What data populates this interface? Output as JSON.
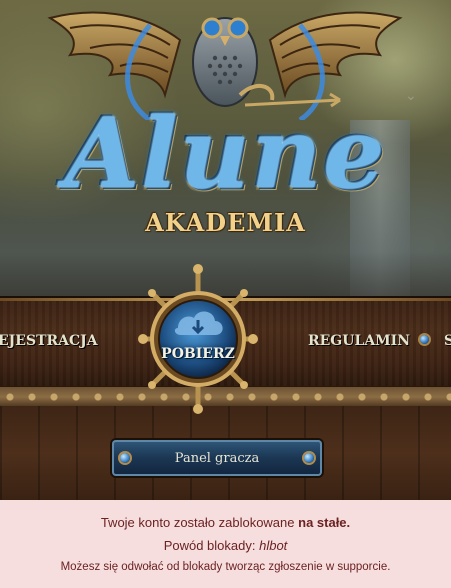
{
  "hero": {
    "logo_title": "Alune",
    "logo_subtitle": "AKADEMIA",
    "scroll_icon": "chevron-down-icon"
  },
  "nav": {
    "left_link": "EJESTRACJA",
    "right_link": "REGULAMIN",
    "right_partial": "S",
    "download_label": "POBIERZ",
    "download_icon": "cloud-download-icon"
  },
  "panel_button": {
    "label": "Panel gracza"
  },
  "alert": {
    "line1_prefix": "Twoje konto zostało zablokowane ",
    "line1_bold": "na stałe.",
    "line2_prefix": "Powód blokady: ",
    "line2_reason": "hlbot",
    "line3": "Możesz się odwołać od blokady tworząc zgłoszenie w supporcie."
  },
  "colors": {
    "alert_background": "#f7dede",
    "alert_text": "#6b2222",
    "accent_blue": "#2c72b8",
    "gold": "#c7a15b"
  }
}
